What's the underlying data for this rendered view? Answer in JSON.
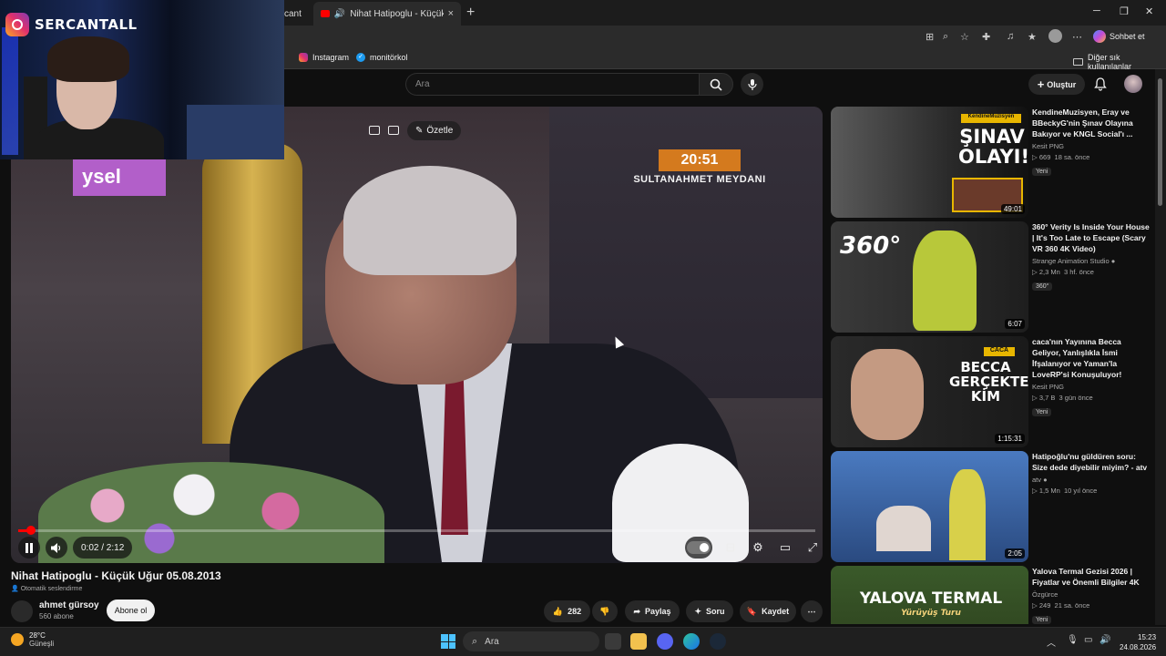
{
  "browser": {
    "prev_tab_label": "cant",
    "active_tab_label": "Nihat Hatipoglu - Küçük U",
    "new_tab_glyph": "+",
    "close_glyph": "×",
    "copilot_label": "Sohbet et",
    "bookmarks": [
      {
        "label": "Instagram",
        "icon": "instagram-icon"
      },
      {
        "label": "monitörkol",
        "icon": "check-icon"
      }
    ],
    "other_bookmarks": "Diğer sık kullanılanlar"
  },
  "webcam": {
    "streamer_name": "SERCANTALL"
  },
  "youtube": {
    "search_placeholder": "Ara",
    "create_label": "Oluştur",
    "video": {
      "overlay_clock": "20:51",
      "overlay_place": "SULTANAHMET MEYDANI",
      "overlay_logo_text": "ysel",
      "summarize_label": "Özetle",
      "time_display": "0:02 / 2:12",
      "progress": 0.016,
      "title": "Nihat Hatipoglu - Küçük Uğur 05.08.2013",
      "auto_dub": "Otomatik seslendirme"
    },
    "channel": {
      "name": "ahmet gürsoy",
      "subscribers": "560 abone",
      "subscribe_label": "Abone ol"
    },
    "actions": {
      "likes": "282",
      "share": "Paylaş",
      "ask": "Soru",
      "save": "Kaydet"
    },
    "suggestions": [
      {
        "title": "KendineMuzisyen, Eray ve BBeckyG'nin Şınav Olayına Bakıyor ve KNGL Social'ı ...",
        "channel": "Kesit PNG",
        "views": "669",
        "age": "18 sa. önce",
        "badge": "Yeni",
        "duration": "49:01",
        "thumb_text": "ŞINAV OLAYI!",
        "thumb_tag": "KendineMuzisyen"
      },
      {
        "title": "360° Verity Is Inside Your House | It's Too Late to Escape (Scary VR 360 4K Video)",
        "channel": "Strange Animation Studio",
        "views": "2,3 Mn",
        "age": "3 hf. önce",
        "badge": "360°",
        "duration": "6:07",
        "thumb_text": "360°"
      },
      {
        "title": "caca'nın Yayınına Becca Geliyor, Yanlışlıkla İsmi İfşalanıyor ve Yaman'la LoveRP'si Konuşuluyor!",
        "channel": "Kesit PNG",
        "views": "3,7 B",
        "age": "3 gün önce",
        "badge": "Yeni",
        "duration": "1:15:31",
        "thumb_text": "BECCA GERÇEKTE KİM",
        "thumb_tag": "CACA"
      },
      {
        "title": "Hatipoğlu'nu güldüren soru: Size dede diyebilir miyim? - atv",
        "channel": "atv",
        "views": "1,5 Mn",
        "age": "10 yıl önce",
        "badge": "",
        "duration": "2:05",
        "thumb_text": ""
      },
      {
        "title": "Yalova Termal Gezisi 2026 | Fiyatlar ve Önemli Bilgiler 4K",
        "channel": "Özgürce",
        "views": "249",
        "age": "21 sa. önce",
        "badge": "Yeni",
        "duration": "",
        "thumb_text": "YALOVA TERMAL",
        "thumb_sub": "Yürüyüş Turu"
      }
    ]
  },
  "taskbar": {
    "temperature": "28°C",
    "weather": "Güneşli",
    "search_label": "Ara",
    "time": "15:23",
    "date": "24.08.2026"
  },
  "colors": {
    "accent_red": "#ff0000",
    "background": "#0f0f0f",
    "windows_blue": "#4cc2ff"
  }
}
